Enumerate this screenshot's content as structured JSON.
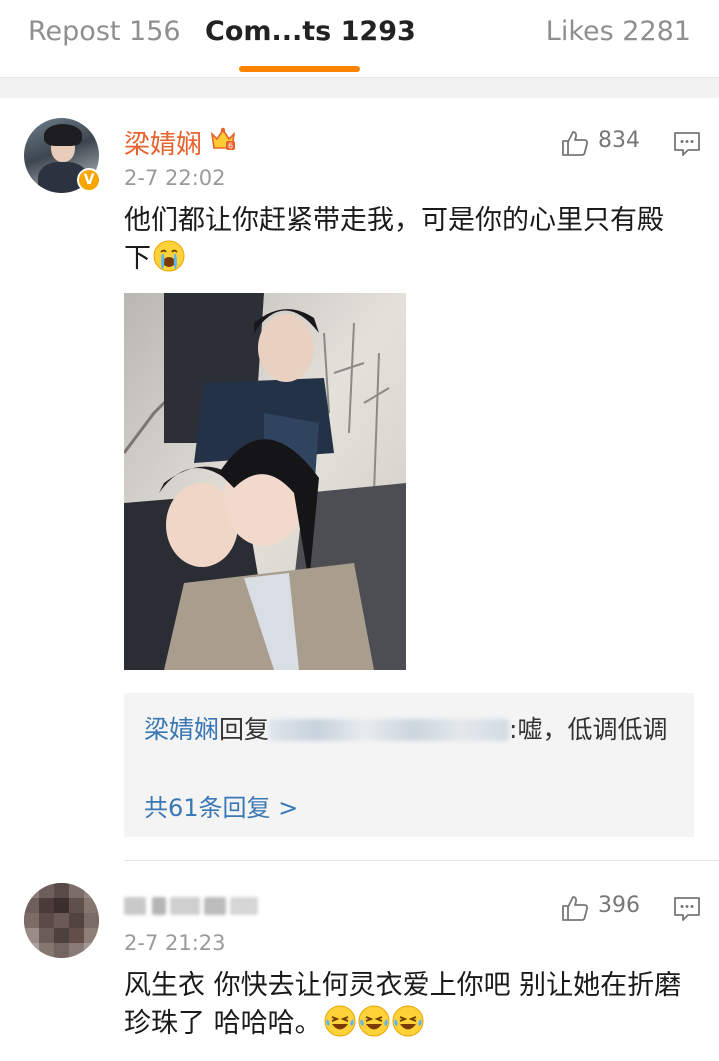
{
  "tabs": {
    "repost": "Repost 156",
    "comments": "Com...ts 1293",
    "likes": "Likes 2281",
    "active": "comments",
    "accent_color": "#ff8200"
  },
  "comments": [
    {
      "username": "梁婧娴",
      "verified": true,
      "vip_icon": "crown-vip-icon",
      "time": "2-7 22:02",
      "like_count": "834",
      "text": "他们都让你赶紧带走我，可是你的心里只有殿下",
      "emoji": "crying-face-icon",
      "has_photo": true,
      "reply": {
        "author": "梁婧娴",
        "verb": "回复",
        "text": ":嘘，低调低调",
        "more": "共61条回复 >"
      }
    },
    {
      "username": "",
      "time": "2-7 21:23",
      "like_count": "396",
      "text": "风生衣  你快去让何灵衣爱上你吧  别让她在折磨珍珠了  哈哈哈。",
      "emoji": "laughing-tears-icon",
      "emoji_count": 3
    }
  ],
  "colors": {
    "username": "#e8622e",
    "link": "#3a77b5",
    "meta": "#9a9a9a"
  }
}
